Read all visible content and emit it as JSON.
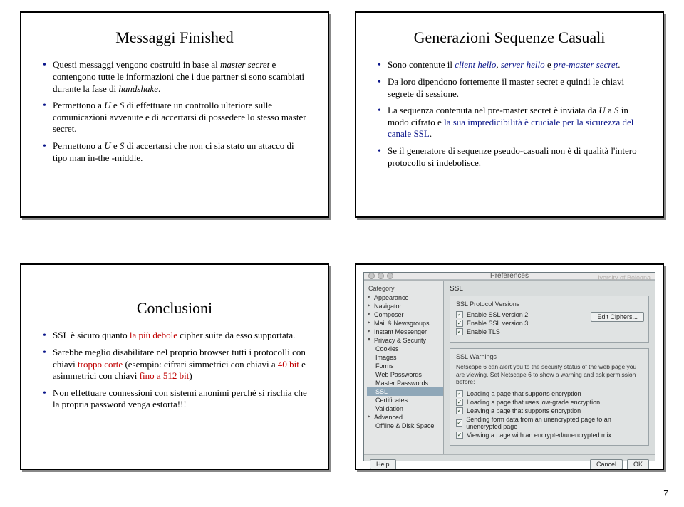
{
  "page_number": "7",
  "slide1": {
    "title": "Messaggi Finished",
    "b1a": "Questi messaggi vengono costruiti in base al ",
    "b1b": "master secret",
    "b1c": " e contengono tutte le informazioni che i due partner si sono scambiati durante la fase di ",
    "b1d": "handshake",
    "b1e": ".",
    "b2a": "Permettono a ",
    "b2b": "U",
    "b2c": " e ",
    "b2d": "S",
    "b2e": " di effettuare un controllo ulteriore sulle comunicazioni avvenute e di accertarsi di possedere lo stesso master secret.",
    "b3a": "Permettono a ",
    "b3b": "U",
    "b3c": " e ",
    "b3d": "S",
    "b3e": " di accertarsi che non ci sia stato un attacco di tipo man in-the -middle."
  },
  "slide2": {
    "title": "Generazioni Sequenze Casuali",
    "b1a": "Sono contenute il ",
    "b1b": "client hello",
    "b1c": ", ",
    "b1d": "server hello",
    "b1e": " e ",
    "b1f": "pre-master secret",
    "b1g": ".",
    "b2": "Da loro dipendono fortemente il master secret e quindi le chiavi segrete di sessione.",
    "b3a": "La sequenza contenuta nel pre-master secret è inviata da ",
    "b3b": "U",
    "b3c": " a ",
    "b3d": "S",
    "b3e": " in modo cifrato e ",
    "b3f": "la sua impredicibilità è cruciale per la sicurezza del canale SSL",
    "b3g": ".",
    "b4": "Se il generatore di sequenze pseudo-casuali non è di qualità l'intero protocollo si indebolisce."
  },
  "slide3": {
    "title": "Conclusioni",
    "b1a": "SSL è sicuro quanto ",
    "b1b": "la più debole",
    "b1c": " cipher suite da esso supportata.",
    "b2a": "Sarebbe meglio disabilitare nel proprio browser tutti i protocolli con chiavi ",
    "b2b": "troppo corte",
    "b2c": " (esempio: cifrari simmetrici con chiavi a ",
    "b2d": "40 bit",
    "b2e": " e asimmetrici con chiavi ",
    "b2f": "fino a 512 bit",
    "b2g": ")",
    "b3": "Non effettuare connessioni con sistemi anonimi perché si rischia che la propria password venga estorta!!!"
  },
  "pref": {
    "window_title": "Preferences",
    "ghost": "iversity of Bologna",
    "side_header": "Category",
    "side": {
      "appearance": "Appearance",
      "navigator": "Navigator",
      "composer": "Composer",
      "mail": "Mail & Newsgroups",
      "im": "Instant Messenger",
      "privsec": "Privacy & Security",
      "cookies": "Cookies",
      "images": "Images",
      "forms": "Forms",
      "webpw": "Web Passwords",
      "masterpw": "Master Passwords",
      "ssl": "SSL",
      "certs": "Certificates",
      "validation": "Validation",
      "advanced": "Advanced",
      "offline": "Offline & Disk Space"
    },
    "main_title": "SSL",
    "versions": {
      "group_title": "SSL Protocol Versions",
      "v2": "Enable SSL version 2",
      "v3": "Enable SSL version 3",
      "tls": "Enable TLS",
      "edit": "Edit Ciphers..."
    },
    "warnings": {
      "group_title": "SSL Warnings",
      "intro": "Netscape 6 can alert you to the security status of the web page you are viewing. Set Netscape 6 to show a warning and ask permission before:",
      "w1": "Loading a page that supports encryption",
      "w2": "Loading a page that uses low-grade encryption",
      "w3": "Leaving a page that supports encryption",
      "w4": "Sending form data from an unencrypted page to an unencrypted page",
      "w5": "Viewing a page with an encrypted/unencrypted mix"
    },
    "buttons": {
      "help": "Help",
      "cancel": "Cancel",
      "ok": "OK"
    }
  }
}
